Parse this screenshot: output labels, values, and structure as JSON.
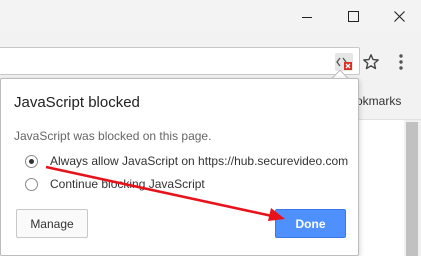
{
  "window": {
    "controls": [
      {
        "icon": "minimize-icon"
      },
      {
        "icon": "maximize-icon"
      },
      {
        "icon": "close-icon"
      }
    ]
  },
  "toolbar": {
    "omnibox_status_icon": "javascript-blocked-icon",
    "bookmark_icon": "star-icon",
    "menu_icon": "more-vertical-icon"
  },
  "bookmarks_bar": {
    "label": "okmarks"
  },
  "bubble": {
    "title": "JavaScript blocked",
    "description": "JavaScript was blocked on this page.",
    "options": [
      {
        "label": "Always allow JavaScript on https://hub.securevideo.com",
        "selected": true
      },
      {
        "label": "Continue blocking JavaScript",
        "selected": false
      }
    ],
    "manage_label": "Manage",
    "done_label": "Done"
  },
  "colors": {
    "done_button": "#4d90fe",
    "annotation_arrow": "#e8121b"
  }
}
